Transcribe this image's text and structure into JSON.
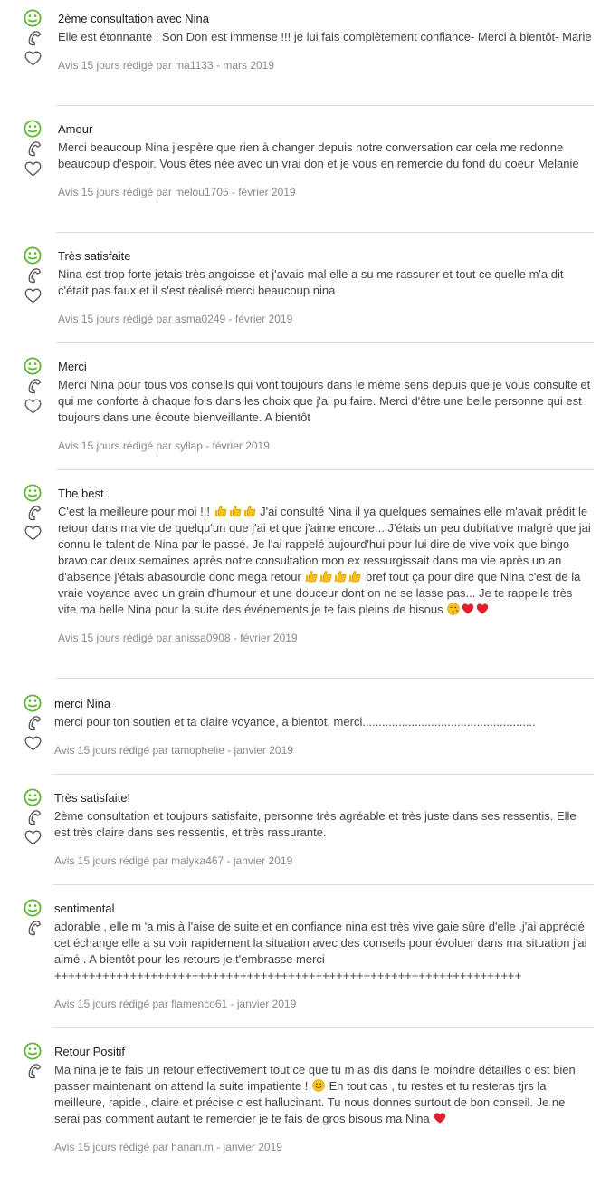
{
  "reviews": [
    {
      "title": "2ème consultation avec Nina",
      "text": "Elle est étonnante ! Son Don est immense !!! je lui fais complètement confiance- Merci à bientôt- Marie",
      "meta": "Avis 15 jours rédigé par ma1133 - mars 2019"
    },
    {
      "title": "Amour",
      "text": "Merci beaucoup Nina j'espère que rien à changer depuis notre conversation car cela me redonne beaucoup d'espoir. Vous êtes née avec un vrai don et je vous en remercie du fond du coeur Melanie",
      "meta": "Avis 15 jours rédigé par melou1705 - février 2019"
    },
    {
      "title": "Très satisfaite",
      "text": "Nina est trop forte jetais très angoisse et j'avais mal elle a su me rassurer et tout ce quelle m'a dit c'était pas faux et il s'est réalisé merci beaucoup nina",
      "meta": "Avis 15 jours rédigé par asma0249 - février 2019"
    },
    {
      "title": "Merci",
      "text": "Merci Nina pour tous vos conseils qui vont toujours dans le même sens depuis que je vous consulte et qui me conforte à chaque fois dans les choix que j'ai pu faire. Merci d'être une belle personne qui est toujours dans une écoute bienveillante. A bientôt",
      "meta": "Avis 15 jours rédigé par syllap - février 2019"
    },
    {
      "title": "The best",
      "text_parts": [
        "C'est la meilleure pour moi !!! ",
        " J'ai consulté Nina il ya quelques semaines elle m'avait prédit le retour dans ma vie de quelqu'un que j'ai et que j'aime encore... J'étais un peu dubitative malgré que jai connu le talent de Nina par le passé. Je l'ai rappelé aujourd'hui pour lui dire de vive voix que bingo bravo car deux semaines après notre consultation mon ex ressurgissait dans ma vie après un an d'absence j'étais abasourdie donc mega retour ",
        " bref tout ça pour dire que Nina c'est de la vraie voyance avec un grain d'humour et une douceur dont on ne se lasse pas... Je te rappelle très vite ma belle Nina pour la suite des événements je te fais pleins de bisous"
      ],
      "meta": "Avis 15 jours rédigé par anissa0908 - février 2019"
    },
    {
      "title": "merci Nina",
      "text": "merci pour ton soutien et ta claire voyance, a bientot, merci.....................................................",
      "meta": "Avis 15 jours rédigé par tamophelie - janvier 2019"
    },
    {
      "title": "Très satisfaite!",
      "text": "2ème consultation et toujours satisfaite, personne très agréable et très juste dans ses ressentis. Elle est très claire dans ses ressentis, et très rassurante.",
      "meta": "Avis 15 jours rédigé par malyka467 - janvier 2019"
    },
    {
      "title": "sentimental",
      "text": "adorable , elle m 'a mis à l'aise de suite et en confiance nina est très vive gaie sûre d'elle .j'ai apprécié cet échange elle a su voir rapidement la situation avec des conseils pour évoluer dans ma situation j'ai aimé . A bientôt pour les retours je t'embrasse merci ++++++++++++++++++++++++++++++++++++++++++++++++++++++++++++++++++++",
      "meta": "Avis 15 jours rédigé par flamenco61 - janvier 2019"
    },
    {
      "title": "Retour Positif",
      "text_parts": [
        "Ma nina je te fais un retour effectivement tout ce que tu m as dis dans le moindre détailles c est bien passer maintenant on attend la suite impatiente ! ",
        " En tout cas , tu restes et tu resteras tjrs la meilleure, rapide , claire et précise c est hallucinant. Tu nous donnes surtout de bon conseil. Je ne serai pas comment autant te remercier je te fais de gros bisous ma Nina "
      ],
      "meta": "Avis 15 jours rédigé par hanan.m - janvier 2019"
    }
  ],
  "colors": {
    "accent_green": "#5cb82e",
    "icon_grey": "#555555",
    "divider": "#dddddd",
    "meta_text": "#8a8a8a"
  },
  "icons": [
    "smiley-icon",
    "phone-icon",
    "heart-outline-icon",
    "thumbs-up-emoji",
    "red-heart-emoji",
    "kiss-emoji",
    "smile-emoji"
  ]
}
